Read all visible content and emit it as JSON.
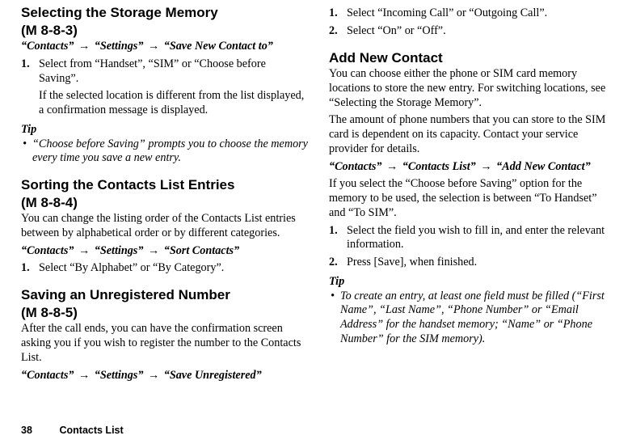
{
  "left": {
    "storage": {
      "title": "Selecting the Storage Memory",
      "mcode": "(M 8-8-3)",
      "bc1": "“Contacts”",
      "bc2": "“Settings”",
      "bc3": "“Save New Contact to”",
      "step1": "Select from “Handset”, “SIM” or “Choose before Saving”.",
      "step1_sub": "If the selected location is different from the list displayed, a confirmation message is displayed.",
      "tip_label": "Tip",
      "tip_text": "“Choose before Saving” prompts you to choose the memory every time you save a new entry."
    },
    "sorting": {
      "title": "Sorting the Contacts List Entries",
      "mcode": "(M 8-8-4)",
      "intro": "You can change the listing order of the Contacts List entries between by alphabetical order or by different categories.",
      "bc1": "“Contacts”",
      "bc2": "“Settings”",
      "bc3": "“Sort Contacts”",
      "step1": "Select “By Alphabet” or “By Category”."
    },
    "saving": {
      "title": "Saving an Unregistered Number",
      "mcode": "(M 8-8-5)",
      "intro": "After the call ends, you can have the confirmation screen asking you if you wish to register the number to the Contacts List.",
      "bc1": "“Contacts”",
      "bc2": "“Settings”",
      "bc3": "“Save Unregistered”"
    }
  },
  "right": {
    "calls": {
      "step1": "Select “Incoming Call” or “Outgoing Call”.",
      "step2": "Select “On” or “Off”."
    },
    "addnew": {
      "title": "Add New Contact",
      "intro1": "You can choose either the phone or SIM card memory locations to store the new entry. For switching locations, see “Selecting the Storage Memory”.",
      "intro2": "The amount of phone numbers that you can store to the SIM card is dependent on its capacity. Contact your service provider for details.",
      "bc1": "“Contacts”",
      "bc2": "“Contacts List”",
      "bc3": "“Add New Contact”",
      "intro3": "If you select the “Choose before Saving” option for the memory to be used, the selection is between “To Handset” and “To SIM”.",
      "step1": "Select the field you wish to fill in, and enter the relevant information.",
      "step2": "Press [Save], when finished.",
      "tip_label": "Tip",
      "tip_text": "To create an entry, at least one field must be filled (“First Name”, “Last Name”, “Phone Number” or “Email Address” for the handset memory; “Name” or “Phone Number” for the SIM memory)."
    }
  },
  "arrow": "→",
  "footer": {
    "page": "38",
    "section": "Contacts List"
  }
}
